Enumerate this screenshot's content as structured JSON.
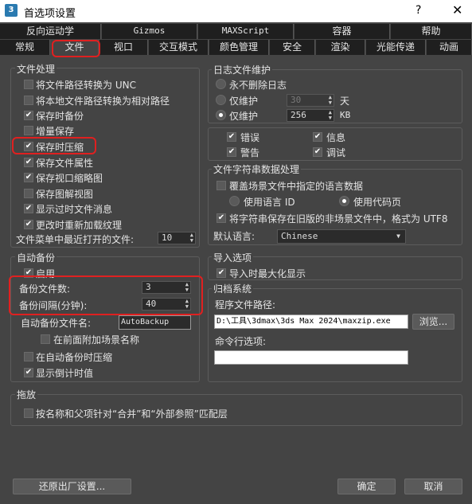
{
  "window": {
    "icon": "3",
    "title": "首选项设置",
    "help": "?",
    "close": "✕"
  },
  "tabs_top": [
    "反向运动学",
    "Gizmos",
    "MAXScript",
    "容器",
    "帮助"
  ],
  "tabs_bottom": [
    "常规",
    "文件",
    "视口",
    "交互模式",
    "颜色管理",
    "安全",
    "渲染",
    "光能传递",
    "动画"
  ],
  "active_tab": "文件",
  "file_handling": {
    "title": "文件处理",
    "items": [
      {
        "label": "将文件路径转换为 UNC",
        "checked": false
      },
      {
        "label": "将本地文件路径转换为相对路径",
        "checked": false
      },
      {
        "label": "保存时备份",
        "checked": true
      },
      {
        "label": "增量保存",
        "checked": false
      },
      {
        "label": "保存时压缩",
        "checked": true
      },
      {
        "label": "保存文件属性",
        "checked": true
      },
      {
        "label": "保存视口缩略图",
        "checked": true
      },
      {
        "label": "保存图解视图",
        "checked": false
      },
      {
        "label": "显示过时文件消息",
        "checked": true
      },
      {
        "label": "更改时重新加载纹理",
        "checked": true
      }
    ],
    "recent_label": "文件菜单中最近打开的文件:",
    "recent_value": "10"
  },
  "auto_backup": {
    "title": "自动备份",
    "enable_label": "启用",
    "enable_checked": true,
    "num_files_label": "备份文件数:",
    "num_files_value": "3",
    "interval_label": "备份间隔(分钟):",
    "interval_value": "40",
    "filename_label": "自动备份文件名:",
    "filename_value": "AutoBackup",
    "prepend_label": "在前面附加场景名称",
    "prepend_checked": false,
    "compress_label": "在自动备份时压缩",
    "compress_checked": false,
    "countdown_label": "显示倒计时值",
    "countdown_checked": true
  },
  "log": {
    "title": "日志文件维护",
    "never_delete": "永不删除日志",
    "keep_days_label": "仅维护",
    "keep_days_value": "30",
    "keep_days_unit": "天",
    "keep_kb_label": "仅维护",
    "keep_kb_value": "256",
    "keep_kb_unit": "KB",
    "selected": "kb",
    "errors": "错误",
    "info": "信息",
    "warnings": "警告",
    "debug": "调试"
  },
  "string_data": {
    "title": "文件字符串数据处理",
    "override_label": "覆盖场景文件中指定的语言数据",
    "override_checked": false,
    "use_language_id": "使用语言 ID",
    "use_code_page": "使用代码页",
    "code_page_selected": true,
    "save_old_label": "将字符串保存在旧版的非场景文件中，格式为 UTF8",
    "save_old_checked": true,
    "default_lang_label": "默认语言:",
    "default_lang_value": "Chinese"
  },
  "import": {
    "title": "导入选项",
    "maximize_label": "导入时最大化显示",
    "maximize_checked": true
  },
  "archive": {
    "title": "归档系统",
    "program_label": "程序文件路径:",
    "program_value": "D:\\工具\\3dmax\\3ds Max 2024\\maxzip.exe",
    "browse": "浏览...",
    "cmdline_label": "命令行选项:",
    "cmdline_value": ""
  },
  "drag": {
    "title": "拖放",
    "match_label": "按名称和父项针对“合并”和“外部参照”匹配层",
    "match_checked": false
  },
  "buttons": {
    "restore": "还原出厂设置...",
    "ok": "确定",
    "cancel": "取消"
  },
  "colors": {
    "highlight": "#e02020",
    "background": "#444444",
    "tab_bg": "#1f1f1f"
  }
}
